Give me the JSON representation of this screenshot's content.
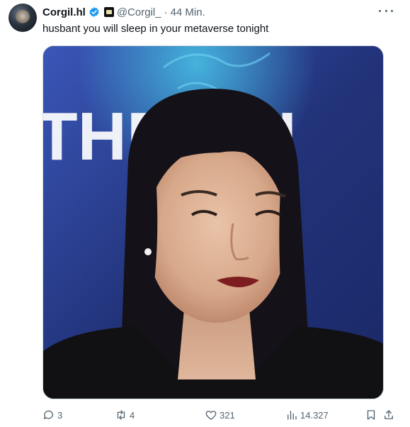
{
  "author": {
    "display_name": "Corgil.hl",
    "handle": "@Corgil_",
    "separator": "·",
    "timestamp": "44 Min.",
    "verified": true,
    "verified_color": "#1d9bf0"
  },
  "tweet": {
    "text": "husbant you will sleep in your metaverse tonight"
  },
  "media": {
    "background_text": "THR    GH"
  },
  "actions": {
    "replies": "3",
    "retweets": "4",
    "likes": "321",
    "views": "14.327"
  },
  "icons": {
    "more": "more-horizontal-icon",
    "reply": "reply-icon",
    "retweet": "retweet-icon",
    "like": "heart-icon",
    "views": "views-bar-chart-icon",
    "bookmark": "bookmark-icon",
    "share": "share-icon"
  },
  "colors": {
    "text_primary": "#0f1419",
    "text_secondary": "#536471"
  }
}
